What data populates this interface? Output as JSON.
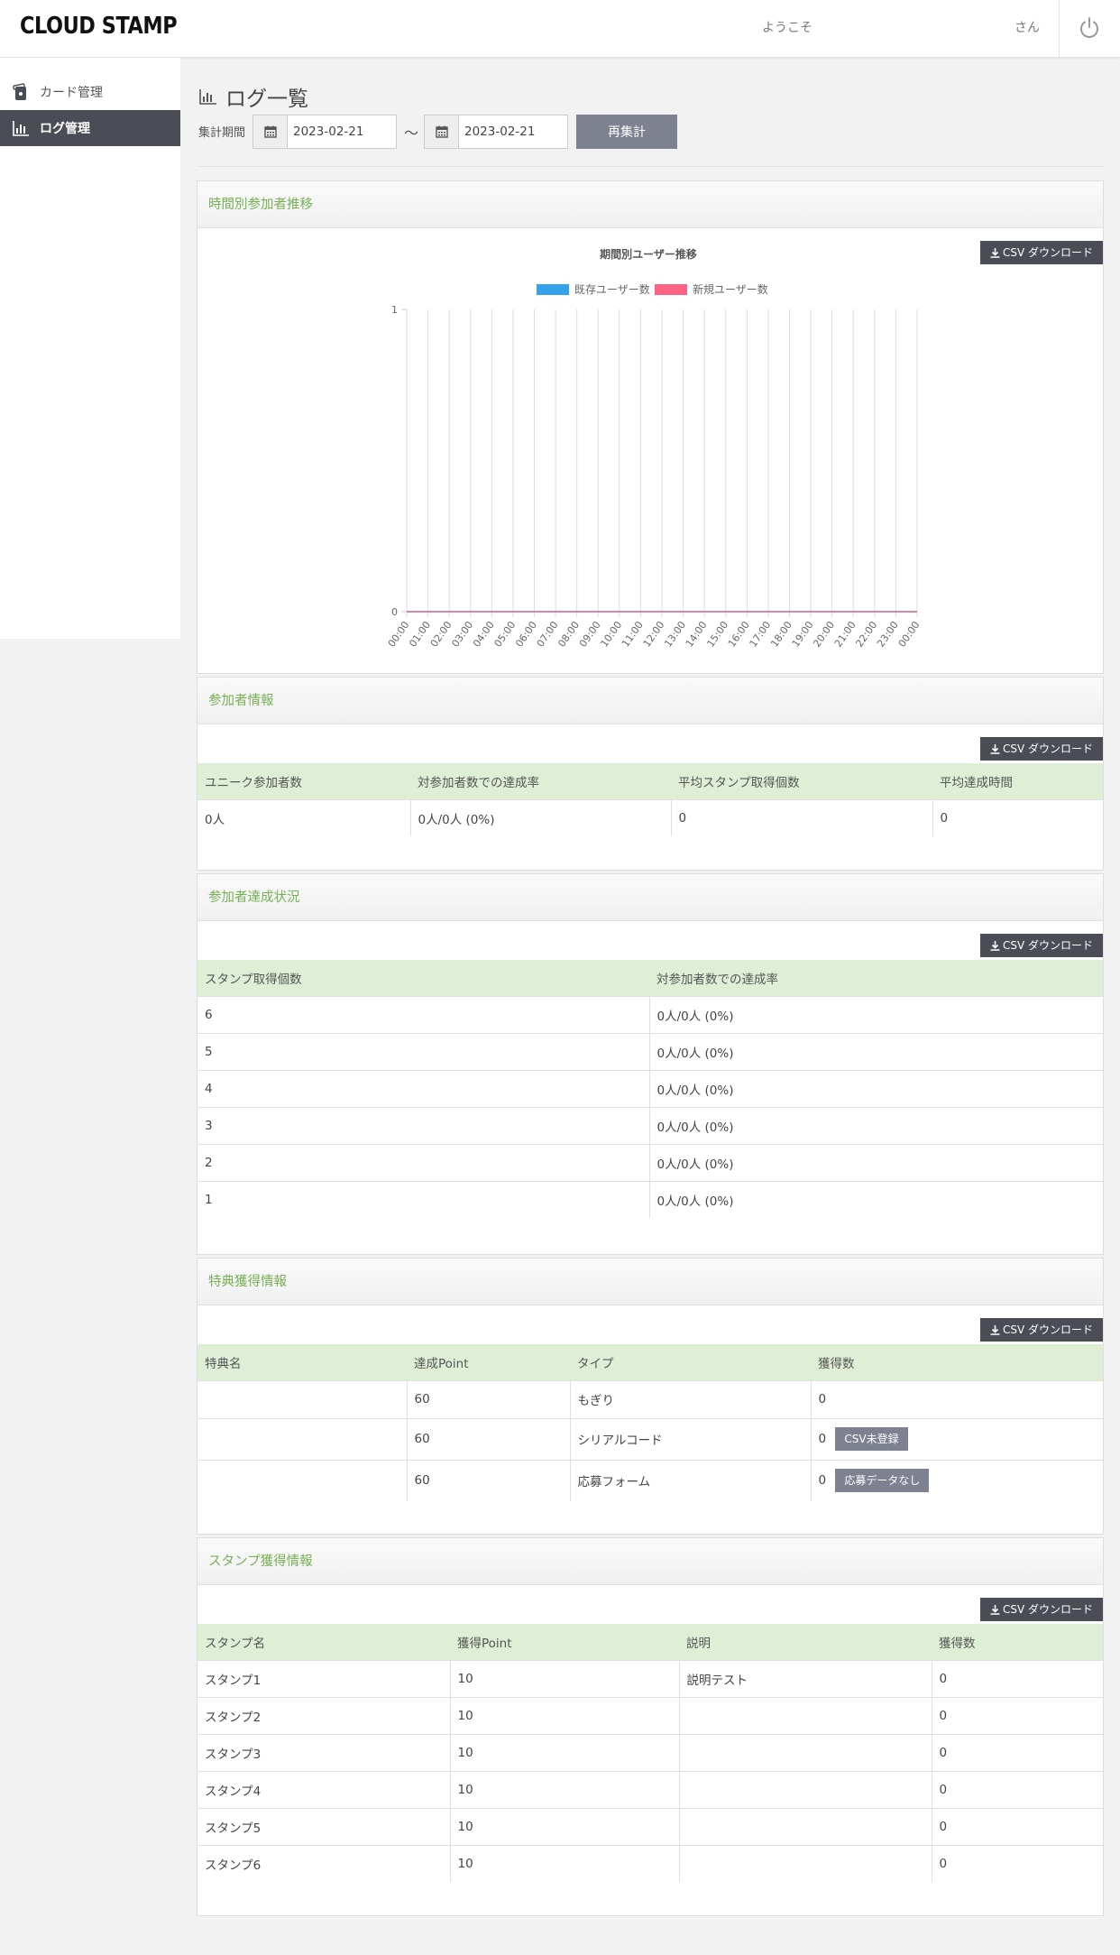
{
  "header": {
    "logo": "CLOUD STAMP",
    "welcome": "ようこそ",
    "san": "さん"
  },
  "sidebar": {
    "items": [
      {
        "label": "カード管理",
        "icon": "card-icon"
      },
      {
        "label": "ログ管理",
        "icon": "bar-chart-icon"
      }
    ]
  },
  "page": {
    "title": "ログ一覧",
    "period_label": "集計期間",
    "start_date": "2023-02-21",
    "tilde": "～",
    "end_date": "2023-02-21",
    "recalc_label": "再集計"
  },
  "csv_label": "CSV ダウンロード",
  "hourly": {
    "heading": "時間別参加者推移",
    "chart_data": {
      "type": "line",
      "title": "期間別ユーザー推移",
      "x": [
        "00:00",
        "01:00",
        "02:00",
        "03:00",
        "04:00",
        "05:00",
        "06:00",
        "07:00",
        "08:00",
        "09:00",
        "10:00",
        "11:00",
        "12:00",
        "13:00",
        "14:00",
        "15:00",
        "16:00",
        "17:00",
        "18:00",
        "19:00",
        "20:00",
        "21:00",
        "22:00",
        "23:00",
        "00:00"
      ],
      "series": [
        {
          "name": "既存ユーザー数",
          "color": "#36a2eb",
          "values": [
            0,
            0,
            0,
            0,
            0,
            0,
            0,
            0,
            0,
            0,
            0,
            0,
            0,
            0,
            0,
            0,
            0,
            0,
            0,
            0,
            0,
            0,
            0,
            0,
            0
          ]
        },
        {
          "name": "新規ユーザー数",
          "color": "#ff6384",
          "values": [
            0,
            0,
            0,
            0,
            0,
            0,
            0,
            0,
            0,
            0,
            0,
            0,
            0,
            0,
            0,
            0,
            0,
            0,
            0,
            0,
            0,
            0,
            0,
            0,
            0
          ]
        }
      ],
      "ylim": [
        0,
        1
      ],
      "yticks": [
        "0",
        "1"
      ],
      "grid": true,
      "legend": "top"
    }
  },
  "participants": {
    "heading": "参加者情報",
    "columns": [
      "ユニーク参加者数",
      "対参加者数での達成率",
      "平均スタンプ取得個数",
      "平均達成時間"
    ],
    "rows": [
      [
        "0人",
        "0人/0人 (0%)",
        "0",
        "0"
      ]
    ]
  },
  "achievement": {
    "heading": "参加者達成状況",
    "columns": [
      "スタンプ取得個数",
      "対参加者数での達成率"
    ],
    "rows": [
      [
        "6",
        "0人/0人 (0%)"
      ],
      [
        "5",
        "0人/0人 (0%)"
      ],
      [
        "4",
        "0人/0人 (0%)"
      ],
      [
        "3",
        "0人/0人 (0%)"
      ],
      [
        "2",
        "0人/0人 (0%)"
      ],
      [
        "1",
        "0人/0人 (0%)"
      ]
    ]
  },
  "benefits": {
    "heading": "特典獲得情報",
    "columns": [
      "特典名",
      "達成Point",
      "タイプ",
      "獲得数"
    ],
    "rows": [
      {
        "name": "",
        "point": "60",
        "type": "もぎり",
        "count": "0",
        "button": ""
      },
      {
        "name": "",
        "point": "60",
        "type": "シリアルコード",
        "count": "0",
        "button": "CSV未登録"
      },
      {
        "name": "",
        "point": "60",
        "type": "応募フォーム",
        "count": "0",
        "button": "応募データなし"
      }
    ]
  },
  "stamps": {
    "heading": "スタンプ獲得情報",
    "columns": [
      "スタンプ名",
      "獲得Point",
      "説明",
      "獲得数"
    ],
    "rows": [
      [
        "スタンプ1",
        "10",
        "説明テスト",
        "0"
      ],
      [
        "スタンプ2",
        "10",
        "",
        "0"
      ],
      [
        "スタンプ3",
        "10",
        "",
        "0"
      ],
      [
        "スタンプ4",
        "10",
        "",
        "0"
      ],
      [
        "スタンプ5",
        "10",
        "",
        "0"
      ],
      [
        "スタンプ6",
        "10",
        "",
        "0"
      ]
    ]
  }
}
